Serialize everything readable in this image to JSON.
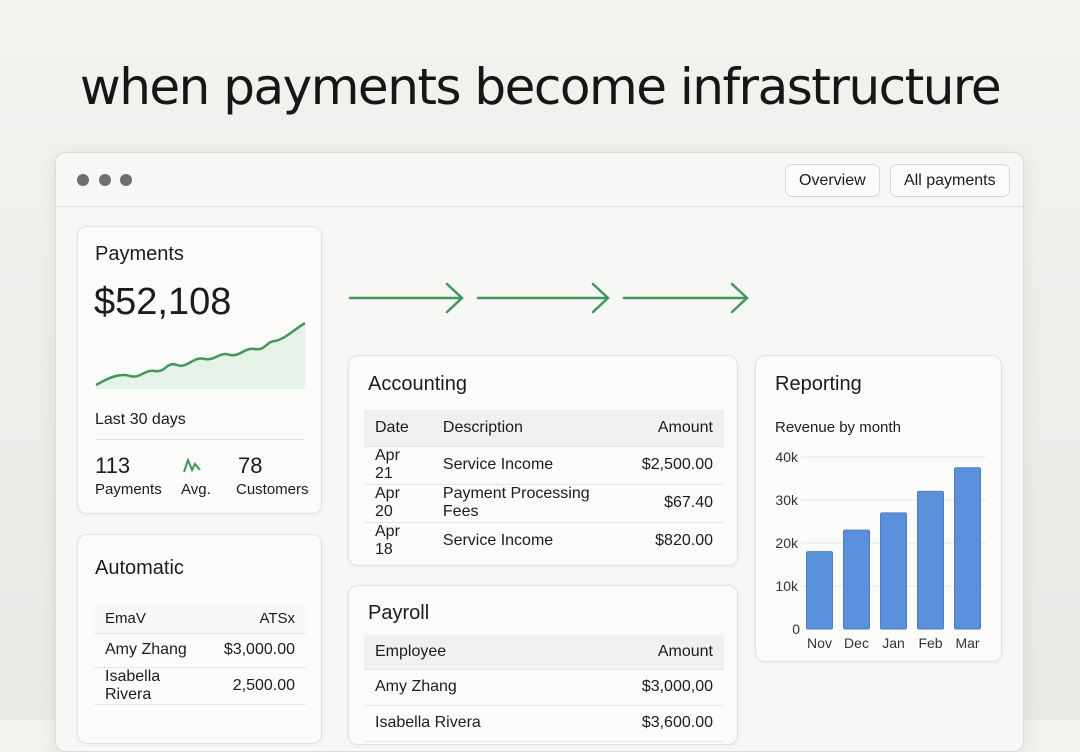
{
  "headline": "when payments become infrastructure",
  "window": {
    "buttons": [
      "Overview",
      "All payments"
    ]
  },
  "payments": {
    "title": "Payments",
    "amount": "$52,108",
    "period": "Last 30 days",
    "stats": [
      {
        "value": "113",
        "label": "Payments"
      },
      {
        "value": "",
        "label": "Avg."
      },
      {
        "value": "78",
        "label": "Customers"
      }
    ],
    "accent": "#3f9a5a"
  },
  "automatic": {
    "title": "Automatic",
    "headers": [
      "EmaV",
      "ATSx"
    ],
    "rows": [
      [
        "Amy Zhang",
        "$3,000.00"
      ],
      [
        "Isabella Rivera",
        "2,500.00"
      ]
    ]
  },
  "accounting": {
    "title": "Accounting",
    "headers": [
      "Date",
      "Description",
      "Amount"
    ],
    "rows": [
      [
        "Apr 21",
        "Service Income",
        "$2,500.00"
      ],
      [
        "Apr 20",
        "Payment Processing Fees",
        "$67.40"
      ],
      [
        "Apr 18",
        "Service Income",
        "$820.00"
      ]
    ]
  },
  "payroll": {
    "title": "Payroll",
    "headers": [
      "Employee",
      "Amount"
    ],
    "rows": [
      [
        "Amy Zhang",
        "$3,000,00"
      ],
      [
        "Isabella Rivera",
        "$3,600.00"
      ]
    ]
  },
  "reporting": {
    "title": "Reporting"
  },
  "chart_data": {
    "type": "bar",
    "title": "Revenue by month",
    "categories": [
      "Nov",
      "Dec",
      "Jan",
      "Feb",
      "Mar"
    ],
    "values": [
      18000,
      23000,
      27000,
      32000,
      37500
    ],
    "ylim": [
      0,
      40000
    ],
    "yticks": [
      0,
      10000,
      20000,
      30000,
      40000
    ],
    "ytick_labels": [
      "0",
      "10k",
      "20k",
      "30k",
      "40k"
    ],
    "grid": true,
    "color": "#5a8fdc"
  }
}
